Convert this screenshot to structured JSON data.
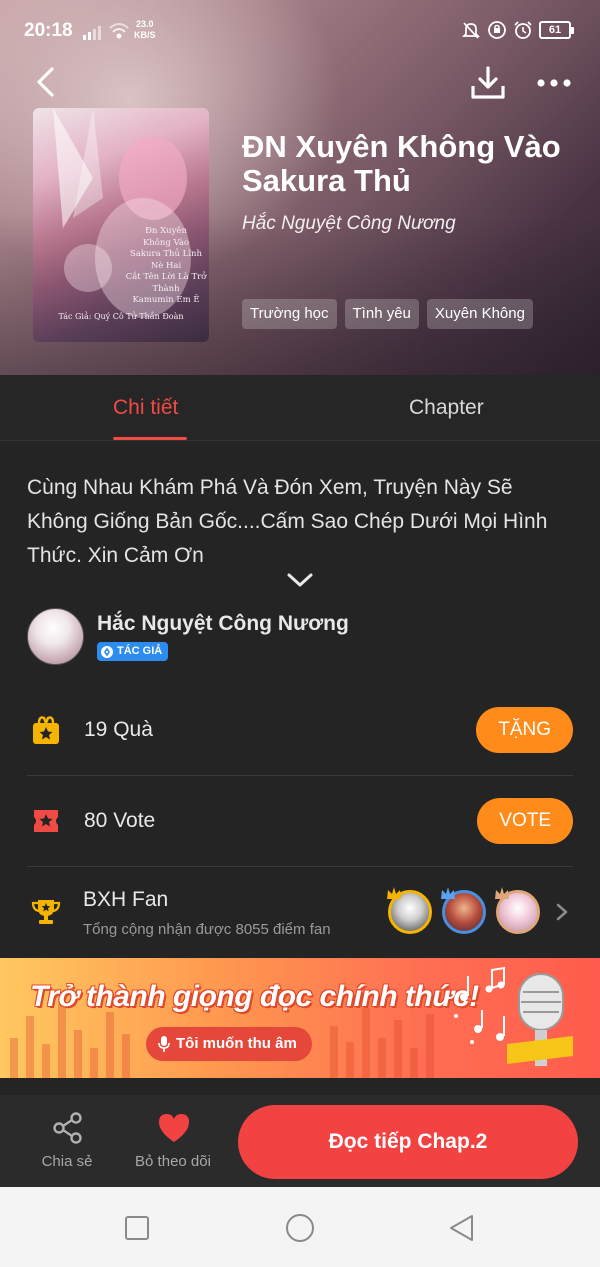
{
  "status": {
    "time": "20:18",
    "speed_value": "23.0",
    "speed_unit": "KB/S",
    "battery": "61"
  },
  "cover": {
    "lines": [
      "Đn Xuyên",
      "Không Vào",
      "Sakura Thủ Lĩnh",
      "Nè Hai",
      "Cắt Tên Lời Là Trở Thành",
      "Kamumin Em Ê"
    ],
    "author_line": "Tác Giả: Quý Cô Tử Thần Đoàn"
  },
  "comic": {
    "title": "ĐN Xuyên Không Vào Sakura Thủ",
    "author": "Hắc Nguyệt Công Nương",
    "tags": [
      "Trường học",
      "Tình yêu",
      "Xuyên Không"
    ]
  },
  "tabs": [
    "Chi tiết",
    "Chapter"
  ],
  "description": "Cùng Nhau Khám Phá Và Đón Xem, Truyện Này Sẽ Không Giống Bản Gốc....Cấm Sao Chép Dưới Mọi Hình Thức. Xin Cảm Ơn",
  "author_block": {
    "name": "Hắc Nguyệt Công Nương",
    "badge": "TÁC GIẢ"
  },
  "stats": {
    "gifts_label": "19 Quà",
    "gift_button": "TẶNG",
    "votes_label": "80 Vote",
    "vote_button": "VOTE"
  },
  "fans": {
    "title": "BXH Fan",
    "subtitle": "Tổng cộng nhận được 8055 điểm fan"
  },
  "banner": {
    "title": "Trở thành giọng đọc chính thức!",
    "button": "Tôi muốn thu âm"
  },
  "bottom": {
    "share": "Chia sẻ",
    "unfollow": "Bỏ theo dõi",
    "read_button": "Đọc tiếp Chap.2"
  },
  "colors": {
    "accent_red": "#f24242",
    "tab_active": "#f04a45",
    "orange_button": "#ff8b1a",
    "gold_icon": "#f5b400",
    "background": "#242424"
  }
}
